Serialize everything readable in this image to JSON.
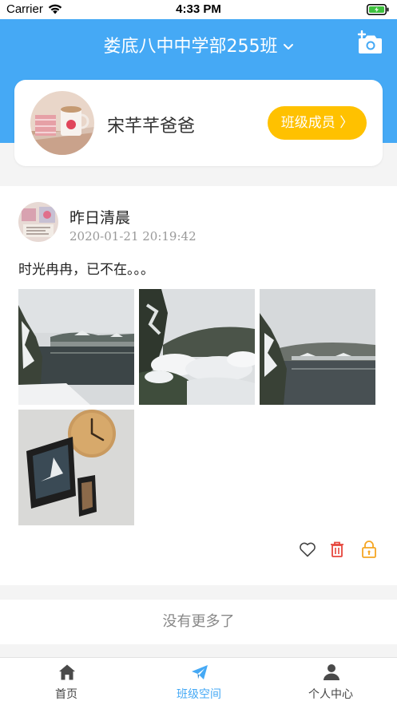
{
  "status_bar": {
    "carrier": "Carrier",
    "time": "4:33 PM"
  },
  "header": {
    "title": "娄底八中中学部255班",
    "title_icon": "chevron-down-icon",
    "action_icon": "add-photo-icon"
  },
  "profile": {
    "name": "宋芊芊爸爸",
    "members_button": "班级成员 〉"
  },
  "post": {
    "author": "昨日清晨",
    "time": "2020-01-21 20:19:42",
    "text": "时光冉冉，已不在。。。",
    "photos": [
      "snowy-lake-pavilion",
      "snow-covered-shrubs",
      "snowy-lake-bridge",
      "wall-clock-and-frames"
    ],
    "actions": [
      "heart-icon",
      "trash-icon",
      "lock-icon"
    ]
  },
  "no_more_text": "没有更多了",
  "tabs": [
    {
      "label": "首页",
      "icon": "home-icon",
      "active": false
    },
    {
      "label": "班级空间",
      "icon": "paper-plane-icon",
      "active": true
    },
    {
      "label": "个人中心",
      "icon": "person-icon",
      "active": false
    }
  ],
  "colors": {
    "primary": "#45a9f5",
    "accent": "#ffc100",
    "delete": "#e6463c",
    "lock": "#f5a623"
  }
}
